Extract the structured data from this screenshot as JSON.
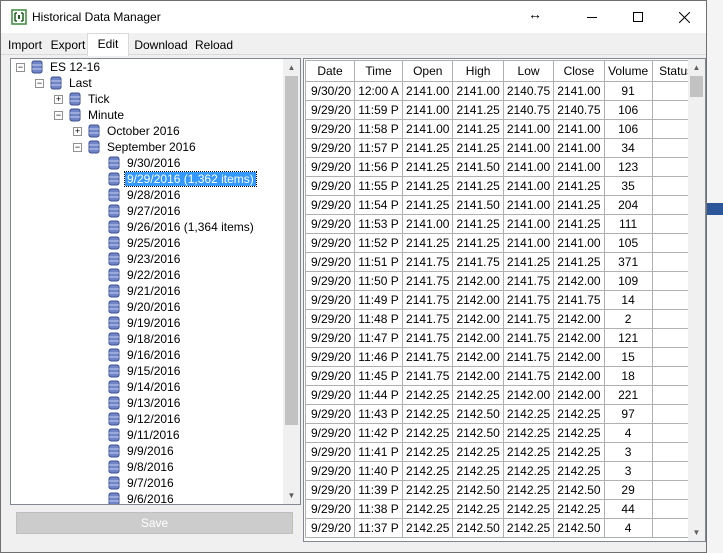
{
  "window": {
    "title": "Historical Data Manager"
  },
  "tabs": [
    "Import",
    "Export",
    "Edit",
    "Download",
    "Reload"
  ],
  "active_tab": "Edit",
  "tree": {
    "root": "ES 12-16",
    "last": "Last",
    "tick": "Tick",
    "minute": "Minute",
    "october": "October 2016",
    "september": "September 2016",
    "days": [
      "9/30/2016",
      "9/29/2016 (1,362 items)",
      "9/28/2016",
      "9/27/2016",
      "9/26/2016 (1,364 items)",
      "9/25/2016",
      "9/23/2016",
      "9/22/2016",
      "9/21/2016",
      "9/20/2016",
      "9/19/2016",
      "9/18/2016",
      "9/16/2016",
      "9/15/2016",
      "9/14/2016",
      "9/13/2016",
      "9/12/2016",
      "9/11/2016",
      "9/9/2016",
      "9/8/2016",
      "9/7/2016",
      "9/6/2016"
    ],
    "selected_day": "9/29/2016 (1,362 items)"
  },
  "save_label": "Save",
  "grid": {
    "columns": [
      "Date",
      "Time",
      "Open",
      "High",
      "Low",
      "Close",
      "Volume",
      "Status"
    ],
    "rows": [
      [
        "9/30/20",
        "12:00 A",
        "2141.00",
        "2141.00",
        "2140.75",
        "2141.00",
        "91",
        ""
      ],
      [
        "9/29/20",
        "11:59 P",
        "2141.00",
        "2141.25",
        "2140.75",
        "2140.75",
        "106",
        ""
      ],
      [
        "9/29/20",
        "11:58 P",
        "2141.00",
        "2141.25",
        "2141.00",
        "2141.00",
        "106",
        ""
      ],
      [
        "9/29/20",
        "11:57 P",
        "2141.25",
        "2141.25",
        "2141.00",
        "2141.00",
        "34",
        ""
      ],
      [
        "9/29/20",
        "11:56 P",
        "2141.25",
        "2141.50",
        "2141.00",
        "2141.00",
        "123",
        ""
      ],
      [
        "9/29/20",
        "11:55 P",
        "2141.25",
        "2141.25",
        "2141.00",
        "2141.25",
        "35",
        ""
      ],
      [
        "9/29/20",
        "11:54 P",
        "2141.25",
        "2141.50",
        "2141.00",
        "2141.25",
        "204",
        ""
      ],
      [
        "9/29/20",
        "11:53 P",
        "2141.00",
        "2141.25",
        "2141.00",
        "2141.25",
        "111",
        ""
      ],
      [
        "9/29/20",
        "11:52 P",
        "2141.25",
        "2141.25",
        "2141.00",
        "2141.00",
        "105",
        ""
      ],
      [
        "9/29/20",
        "11:51 P",
        "2141.75",
        "2141.75",
        "2141.25",
        "2141.25",
        "371",
        ""
      ],
      [
        "9/29/20",
        "11:50 P",
        "2141.75",
        "2142.00",
        "2141.75",
        "2142.00",
        "109",
        ""
      ],
      [
        "9/29/20",
        "11:49 P",
        "2141.75",
        "2142.00",
        "2141.75",
        "2141.75",
        "14",
        ""
      ],
      [
        "9/29/20",
        "11:48 P",
        "2141.75",
        "2142.00",
        "2141.75",
        "2142.00",
        "2",
        ""
      ],
      [
        "9/29/20",
        "11:47 P",
        "2141.75",
        "2142.00",
        "2141.75",
        "2142.00",
        "121",
        ""
      ],
      [
        "9/29/20",
        "11:46 P",
        "2141.75",
        "2142.00",
        "2141.75",
        "2142.00",
        "15",
        ""
      ],
      [
        "9/29/20",
        "11:45 P",
        "2141.75",
        "2142.00",
        "2141.75",
        "2142.00",
        "18",
        ""
      ],
      [
        "9/29/20",
        "11:44 P",
        "2142.25",
        "2142.25",
        "2142.00",
        "2142.00",
        "221",
        ""
      ],
      [
        "9/29/20",
        "11:43 P",
        "2142.25",
        "2142.50",
        "2142.25",
        "2142.25",
        "97",
        ""
      ],
      [
        "9/29/20",
        "11:42 P",
        "2142.25",
        "2142.50",
        "2142.25",
        "2142.25",
        "4",
        ""
      ],
      [
        "9/29/20",
        "11:41 P",
        "2142.25",
        "2142.25",
        "2142.25",
        "2142.25",
        "3",
        ""
      ],
      [
        "9/29/20",
        "11:40 P",
        "2142.25",
        "2142.25",
        "2142.25",
        "2142.25",
        "3",
        ""
      ],
      [
        "9/29/20",
        "11:39 P",
        "2142.25",
        "2142.50",
        "2142.25",
        "2142.50",
        "29",
        ""
      ],
      [
        "9/29/20",
        "11:38 P",
        "2142.25",
        "2142.25",
        "2142.25",
        "2142.25",
        "44",
        ""
      ],
      [
        "9/29/20",
        "11:37 P",
        "2142.25",
        "2142.50",
        "2142.25",
        "2142.50",
        "4",
        ""
      ]
    ]
  },
  "colors": {
    "selection": "#3399ff",
    "icon_blue": "#6f85c8",
    "disabled_button": "#cccccc"
  },
  "icons": {
    "app": "calendar-bracket-icon",
    "node": "database-icon"
  }
}
